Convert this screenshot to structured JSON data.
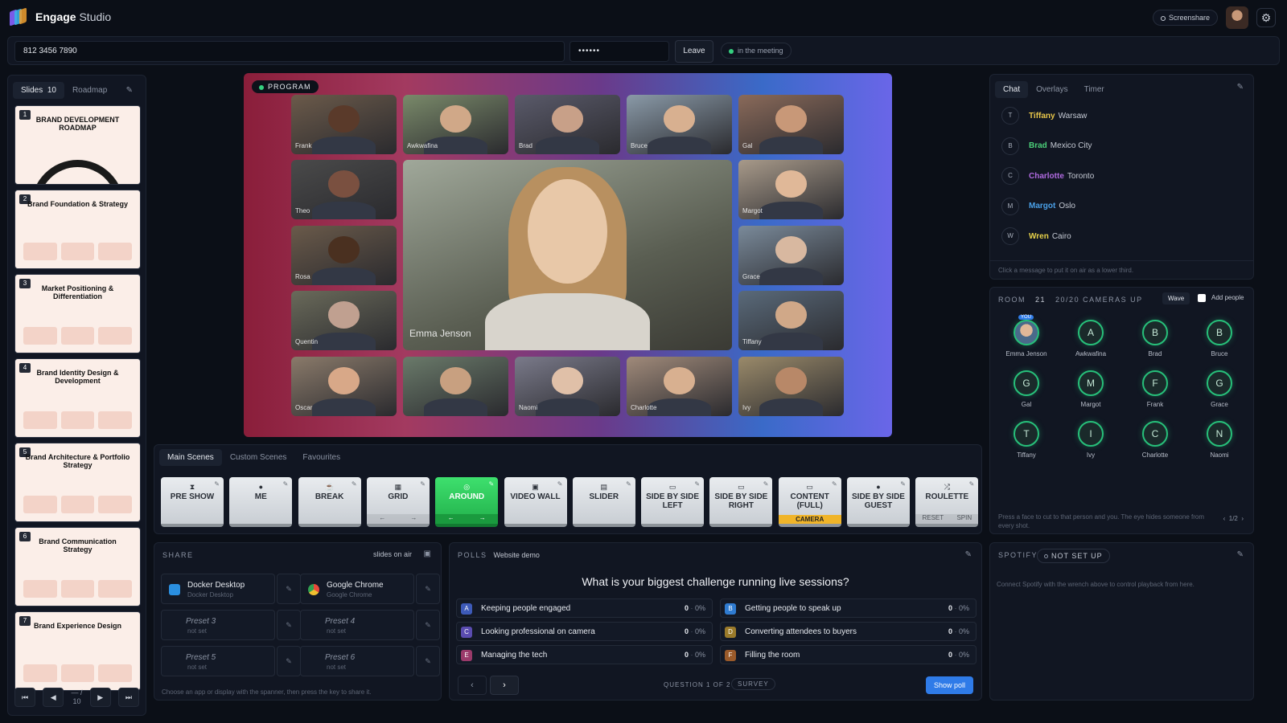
{
  "app": {
    "name": "Engage",
    "name_suffix": "Studio"
  },
  "topbar": {
    "screenshare": "Screenshare"
  },
  "meeting": {
    "phone": "812 3456 7890",
    "passcode": "••••••",
    "leave": "Leave",
    "status": "in the meeting"
  },
  "slides": {
    "tab_slides": "Slides",
    "count": "10",
    "tab_roadmap": "Roadmap",
    "items": [
      {
        "num": "1",
        "title": "BRAND DEVELOPMENT ROADMAP"
      },
      {
        "num": "2",
        "title": "Brand Foundation & Strategy"
      },
      {
        "num": "3",
        "title": "Market Positioning & Differentiation"
      },
      {
        "num": "4",
        "title": "Brand Identity Design & Development"
      },
      {
        "num": "5",
        "title": "Brand Architecture & Portfolio Strategy"
      },
      {
        "num": "6",
        "title": "Brand Communication Strategy"
      },
      {
        "num": "7",
        "title": "Brand Experience Design"
      }
    ],
    "page": "— /",
    "total": "10"
  },
  "program": {
    "label": "PROGRAM",
    "main": "Emma Jenson",
    "tiles": [
      "Frank",
      "Awkwafina",
      "Brad",
      "Bruce",
      "Gal",
      "Theo",
      "Margot",
      "Rosa",
      "Grace",
      "Quentin",
      "Tiffany",
      "Oscar",
      "",
      "Naomi",
      "Charlotte",
      "Ivy"
    ]
  },
  "scenes": {
    "tabs": [
      "Main Scenes",
      "Custom Scenes",
      "Favourites"
    ],
    "items": [
      {
        "icon": "⧗",
        "label": "PRE SHOW"
      },
      {
        "icon": "●",
        "label": "ME"
      },
      {
        "icon": "☕",
        "label": "BREAK"
      },
      {
        "icon": "▦",
        "label": "GRID",
        "sub": [
          "←",
          "→"
        ]
      },
      {
        "icon": "◎",
        "label": "AROUND",
        "sub": [
          "←",
          "→"
        ]
      },
      {
        "icon": "▣",
        "label": "VIDEO WALL"
      },
      {
        "icon": "▤",
        "label": "SLIDER"
      },
      {
        "icon": "▭",
        "label": "SIDE BY SIDE LEFT"
      },
      {
        "icon": "▭",
        "label": "SIDE BY SIDE RIGHT"
      },
      {
        "icon": "▭",
        "label": "CONTENT (FULL)",
        "cam": "CAMERA"
      },
      {
        "icon": "●",
        "label": "SIDE BY SIDE GUEST"
      },
      {
        "icon": "⤮",
        "label": "ROULETTE",
        "sub": [
          "RESET",
          "SPIN"
        ]
      }
    ]
  },
  "share": {
    "title": "SHARE",
    "status": "slides on air",
    "items": [
      {
        "title": "Docker Desktop",
        "sub": "Docker Desktop"
      },
      {
        "title": "Google Chrome",
        "sub": "Google Chrome"
      },
      {
        "title": "Preset 3",
        "sub": "not set"
      },
      {
        "title": "Preset 4",
        "sub": "not set"
      },
      {
        "title": "Preset 5",
        "sub": "not set"
      },
      {
        "title": "Preset 6",
        "sub": "not set"
      }
    ],
    "hint": "Choose an app or display with the spanner, then press the key to share it."
  },
  "polls": {
    "title": "POLLS",
    "tag": "Website demo",
    "question": "What is your biggest challenge running live sessions?",
    "options": [
      {
        "letter": "A",
        "text": "Keeping people engaged",
        "count": "0",
        "pct": "0%",
        "color": "#3d5ab8"
      },
      {
        "letter": "B",
        "text": "Getting people to speak up",
        "count": "0",
        "pct": "0%",
        "color": "#2f7bd0"
      },
      {
        "letter": "C",
        "text": "Looking professional on camera",
        "count": "0",
        "pct": "0%",
        "color": "#5a4cb0"
      },
      {
        "letter": "D",
        "text": "Converting attendees to buyers",
        "count": "0",
        "pct": "0%",
        "color": "#9a7a2a"
      },
      {
        "letter": "E",
        "text": "Managing the tech",
        "count": "0",
        "pct": "0%",
        "color": "#9a3a6a"
      },
      {
        "letter": "F",
        "text": "Filling the room",
        "count": "0",
        "pct": "0%",
        "color": "#9a5a2a"
      }
    ],
    "counter": "QUESTION 1 OF 2",
    "type": "SURVEY",
    "show": "Show poll"
  },
  "chat": {
    "tabs": [
      "Chat",
      "Overlays",
      "Timer"
    ],
    "messages": [
      {
        "init": "T",
        "name": "Tiffany",
        "place": "Warsaw",
        "color": "#e8c64a"
      },
      {
        "init": "B",
        "name": "Brad",
        "place": "Mexico City",
        "color": "#4cd07a"
      },
      {
        "init": "C",
        "name": "Charlotte",
        "place": "Toronto",
        "color": "#b06ae0"
      },
      {
        "init": "M",
        "name": "Margot",
        "place": "Oslo",
        "color": "#4aa0e8"
      },
      {
        "init": "W",
        "name": "Wren",
        "place": "Cairo",
        "color": "#e8d24a"
      }
    ],
    "hint": "Click a message to put it on air as a lower third."
  },
  "room": {
    "title": "ROOM",
    "count": "21",
    "cameras": "20/20 CAMERAS UP",
    "wave": "Wave",
    "add": "Add people",
    "you": "YOU",
    "people": [
      {
        "i": "",
        "n": "Emma Jenson"
      },
      {
        "i": "A",
        "n": "Awkwafina"
      },
      {
        "i": "B",
        "n": "Brad"
      },
      {
        "i": "B",
        "n": "Bruce"
      },
      {
        "i": "G",
        "n": "Gal"
      },
      {
        "i": "M",
        "n": "Margot"
      },
      {
        "i": "F",
        "n": "Frank"
      },
      {
        "i": "G",
        "n": "Grace"
      },
      {
        "i": "T",
        "n": "Tiffany"
      },
      {
        "i": "I",
        "n": "Ivy"
      },
      {
        "i": "C",
        "n": "Charlotte"
      },
      {
        "i": "N",
        "n": "Naomi"
      }
    ],
    "hint": "Press a face to cut to that person and you. The eye hides someone from every shot.",
    "page": "1/2"
  },
  "spotify": {
    "title": "SPOTIFY",
    "status": "NOT SET UP",
    "hint": "Connect Spotify with the wrench above to control playback from here."
  }
}
